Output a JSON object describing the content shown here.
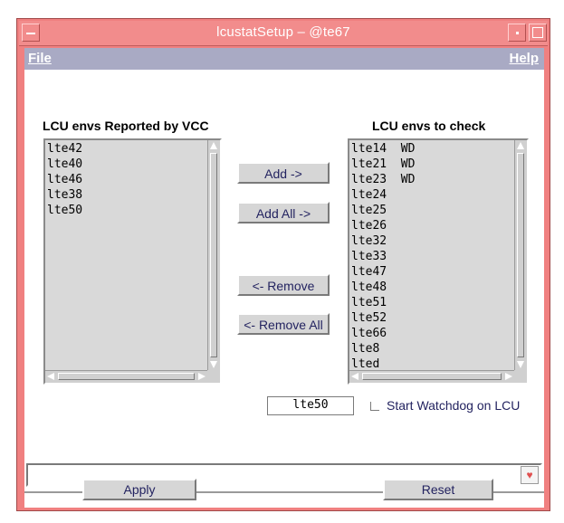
{
  "window": {
    "title": "lcustatSetup – @te67"
  },
  "menubar": {
    "file": "File",
    "help": "Help"
  },
  "left_list": {
    "heading": "LCU envs Reported by VCC",
    "items": [
      "lte42",
      "lte40",
      "lte46",
      "lte38",
      "lte50"
    ]
  },
  "right_list": {
    "heading": "LCU envs to check",
    "items": [
      "lte14  WD",
      "lte21  WD",
      "lte23  WD",
      "lte24",
      "lte25",
      "lte26",
      "lte32",
      "lte33",
      "lte47",
      "lte48",
      "lte51",
      "lte52",
      "lte66",
      "lte8",
      "lted"
    ]
  },
  "buttons": {
    "add": "Add ->",
    "add_all": "Add All ->",
    "remove": "<- Remove",
    "remove_all": "<- Remove All",
    "apply": "Apply",
    "reset": "Reset"
  },
  "selected_env": "lte50",
  "watchdog": {
    "label": "Start Watchdog on LCU",
    "checked": false
  },
  "status": {
    "text": "",
    "corner_icon": "heart-icon"
  },
  "colors": {
    "titlebar": "#f28c8c",
    "menubar": "#a9aac4",
    "button_text": "#232360",
    "list_bg": "#d9d9d9"
  }
}
